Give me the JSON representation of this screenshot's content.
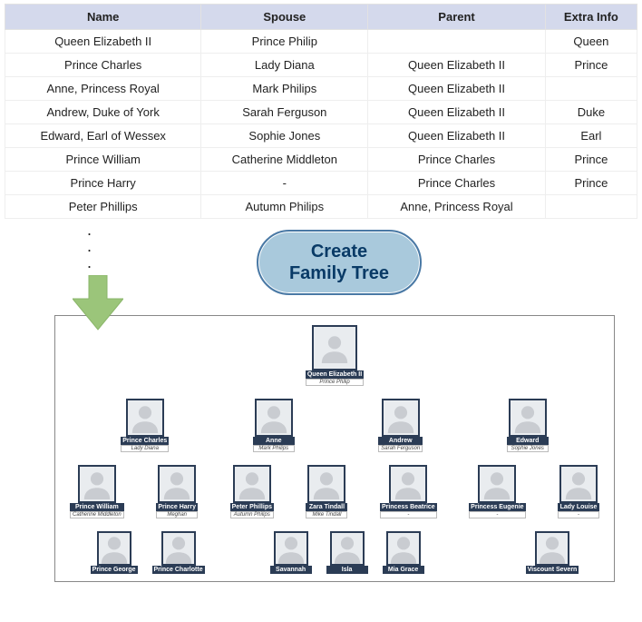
{
  "table": {
    "headers": [
      "Name",
      "Spouse",
      "Parent",
      "Extra Info"
    ],
    "rows": [
      [
        "Queen Elizabeth II",
        "Prince Philip",
        "",
        "Queen"
      ],
      [
        "Prince Charles",
        "Lady Diana",
        "Queen Elizabeth II",
        "Prince"
      ],
      [
        "Anne, Princess Royal",
        "Mark Philips",
        "Queen Elizabeth II",
        ""
      ],
      [
        "Andrew, Duke of York",
        "Sarah Ferguson",
        "Queen Elizabeth II",
        "Duke"
      ],
      [
        "Edward, Earl of Wessex",
        "Sophie Jones",
        "Queen Elizabeth II",
        "Earl"
      ],
      [
        "Prince William",
        "Catherine Middleton",
        "Prince Charles",
        "Prince"
      ],
      [
        "Prince Harry",
        "-",
        "Prince Charles",
        "Prince"
      ],
      [
        "Peter Phillips",
        "Autumn Philips",
        "Anne, Princess Royal",
        ""
      ]
    ]
  },
  "cta": {
    "line1": "Create",
    "line2": "Family Tree"
  },
  "tree": {
    "root": {
      "name": "Queen Elizabeth II",
      "spouse": "Prince Philip"
    },
    "gen2": [
      {
        "name": "Prince Charles",
        "spouse": "Lady Diana"
      },
      {
        "name": "Anne",
        "spouse": "Mark Philips"
      },
      {
        "name": "Andrew",
        "spouse": "Sarah Ferguson"
      },
      {
        "name": "Edward",
        "spouse": "Sophie Jones"
      }
    ],
    "gen3": [
      {
        "name": "Prince William",
        "spouse": "Catherine Middleton"
      },
      {
        "name": "Prince Harry",
        "spouse": "Meghan"
      },
      {
        "name": "Peter Phillips",
        "spouse": "Autumn Philips"
      },
      {
        "name": "Zara Tindall",
        "spouse": "Mike Tindall"
      },
      {
        "name": "Princess Beatrice",
        "spouse": "-"
      },
      {
        "name": "Princess Eugenie",
        "spouse": "-"
      },
      {
        "name": "Lady Louise",
        "spouse": "-"
      }
    ],
    "gen4": [
      {
        "name": "Prince George"
      },
      {
        "name": "Prince Charlotte"
      },
      {
        "name": "Savannah"
      },
      {
        "name": "Isla"
      },
      {
        "name": "Mia Grace"
      },
      {
        "name": "Viscount Severn"
      }
    ]
  }
}
